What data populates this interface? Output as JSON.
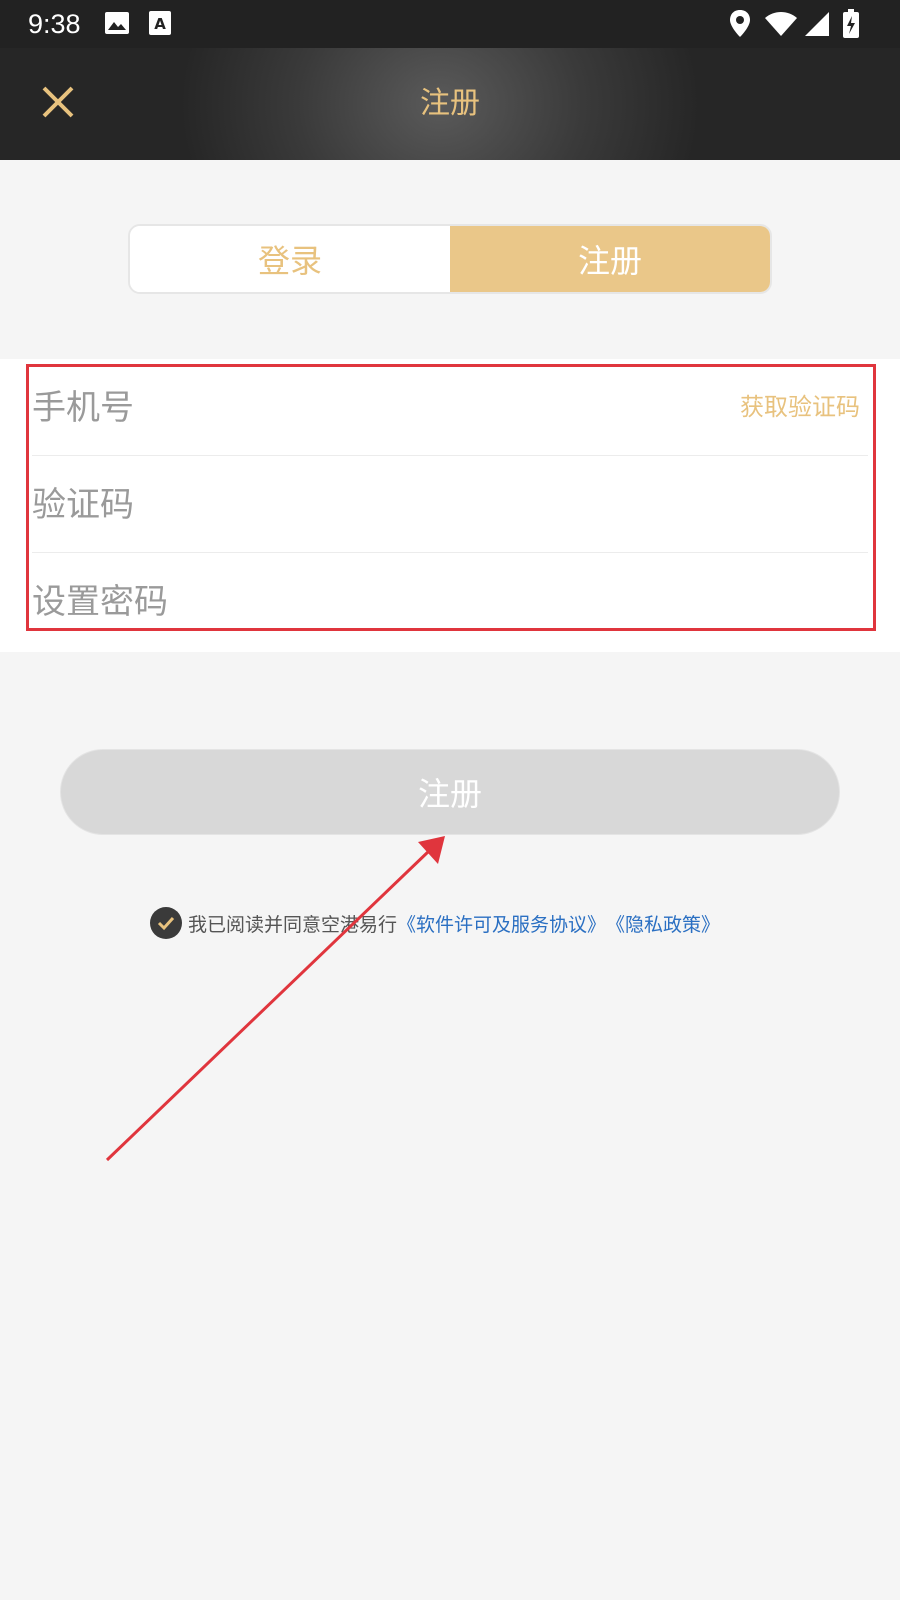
{
  "status_bar": {
    "time": "9:38",
    "left_icons": [
      "image-icon",
      "accessibility-font-icon"
    ],
    "right_icons": [
      "location-pin-icon",
      "wifi-icon",
      "signal-icon",
      "battery-charging-icon"
    ]
  },
  "header": {
    "title": "注册",
    "close_icon": "close-icon"
  },
  "tabs": {
    "login_label": "登录",
    "register_label": "注册",
    "active": "register"
  },
  "form": {
    "phone_placeholder": "手机号",
    "get_code_label": "获取验证码",
    "code_placeholder": "验证码",
    "password_placeholder": "设置密码"
  },
  "submit": {
    "label": "注册"
  },
  "agreement": {
    "checked": true,
    "text": "我已阅读并同意空港易行",
    "license_link": "《软件许可及服务协议》",
    "privacy_link": "《隐私政策》"
  },
  "colors": {
    "accent_gold": "#e8c27e",
    "tab_active_bg": "#eac789",
    "link_blue": "#2a6fc2",
    "annotation_red": "#e0353d",
    "submit_disabled_bg": "#d8d8d8"
  }
}
